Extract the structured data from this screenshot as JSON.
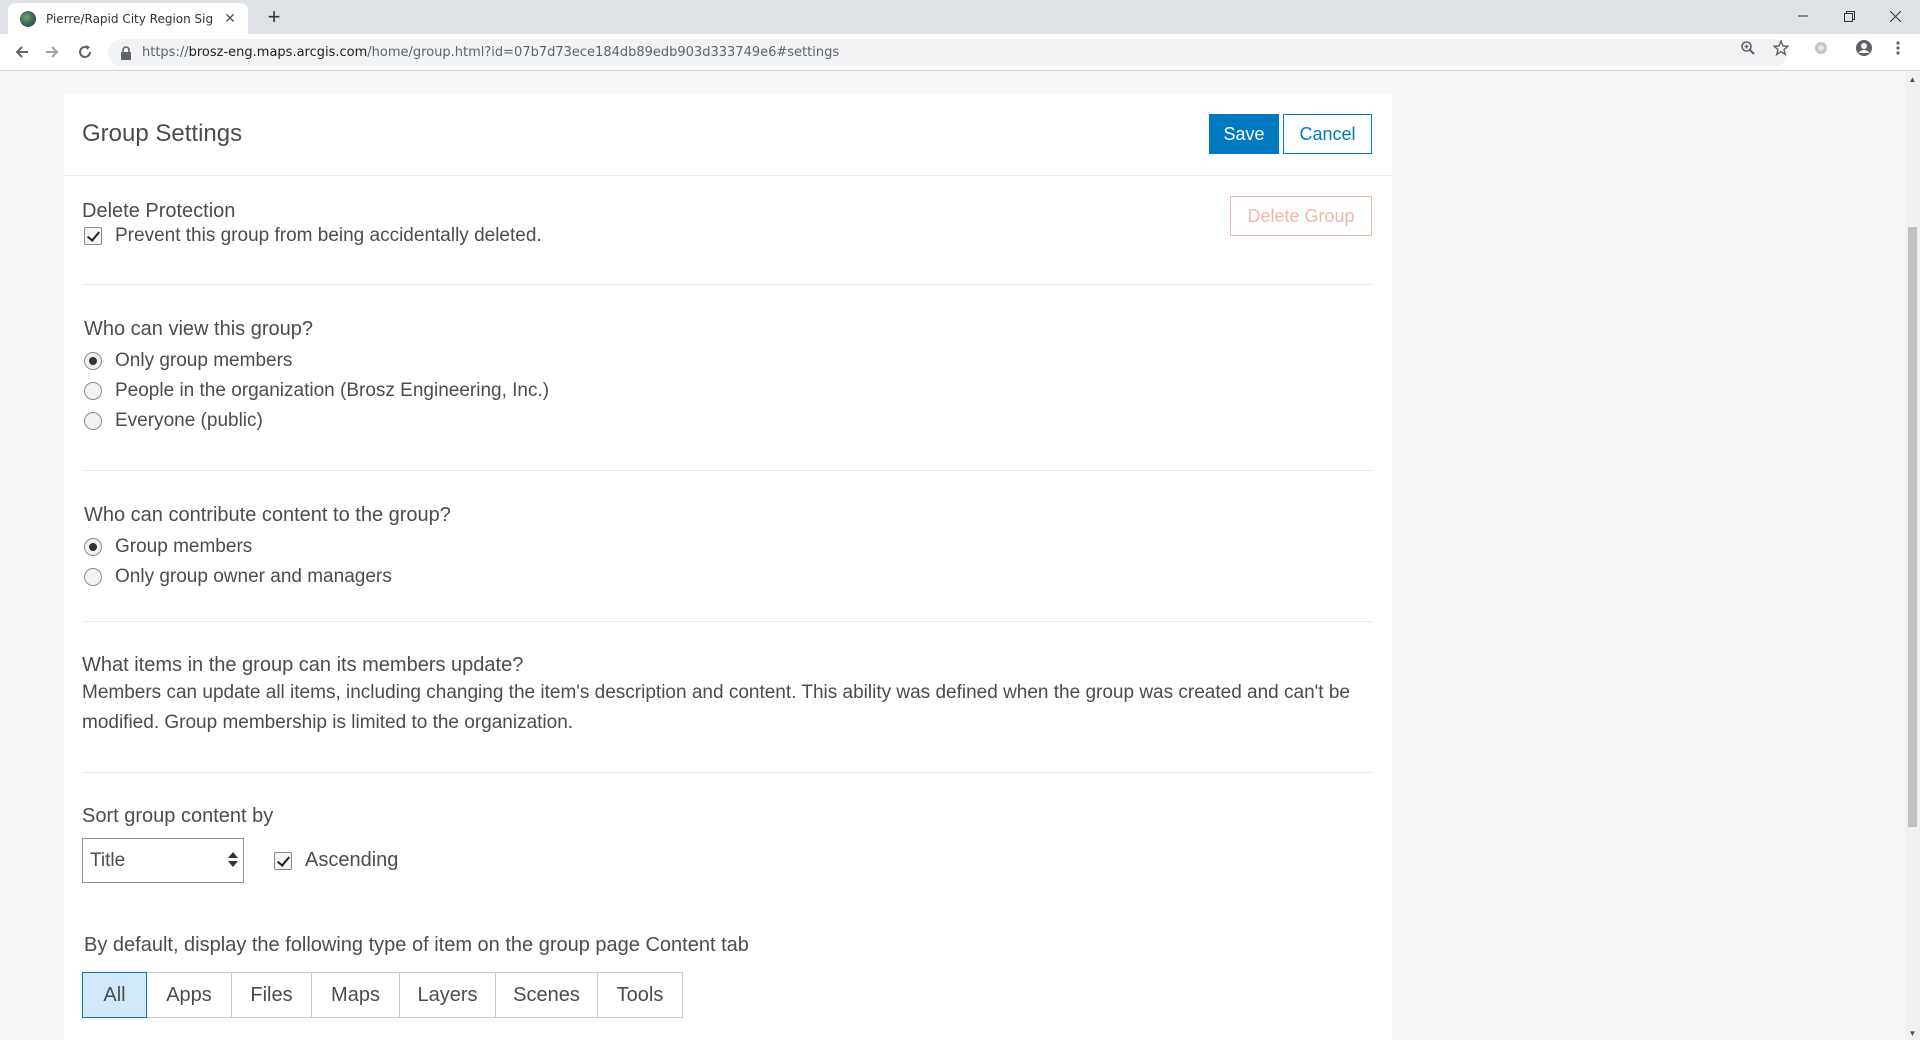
{
  "browser": {
    "tab_title": "Pierre/Rapid City Region Signing",
    "url_prefix": "https://",
    "url_host": "brosz-eng.maps.arcgis.com",
    "url_path": "/home/group.html?id=07b7d73ece184db89edb903d333749e6#settings"
  },
  "header": {
    "title": "Group Settings",
    "save_label": "Save",
    "cancel_label": "Cancel"
  },
  "delete_protection": {
    "title": "Delete Protection",
    "checkbox_label": "Prevent this group from being accidentally deleted.",
    "checked": true,
    "delete_button_label": "Delete Group"
  },
  "view_access": {
    "title": "Who can view this group?",
    "options": [
      {
        "label": "Only group members",
        "selected": true
      },
      {
        "label": "People in the organization (Brosz Engineering, Inc.)",
        "selected": false
      },
      {
        "label": "Everyone (public)",
        "selected": false
      }
    ]
  },
  "contribute_access": {
    "title": "Who can contribute content to the group?",
    "options": [
      {
        "label": "Group members",
        "selected": true
      },
      {
        "label": "Only group owner and managers",
        "selected": false
      }
    ]
  },
  "update_items": {
    "title": "What items in the group can its members update?",
    "description": "Members can update all items, including changing the item's description and content. This ability was defined when the group was created and can't be modified. Group membership is limited to the organization."
  },
  "sort": {
    "title": "Sort group content by",
    "selected": "Title",
    "ascending_label": "Ascending",
    "ascending_checked": true
  },
  "default_type": {
    "title": "By default, display the following type of item on the group page Content tab",
    "options": [
      "All",
      "Apps",
      "Files",
      "Maps",
      "Layers",
      "Scenes",
      "Tools"
    ],
    "active": "All"
  },
  "colors": {
    "accent": "#0079c1",
    "danger_muted": "#f1b6ad",
    "active_bg": "#d2e9f9"
  }
}
